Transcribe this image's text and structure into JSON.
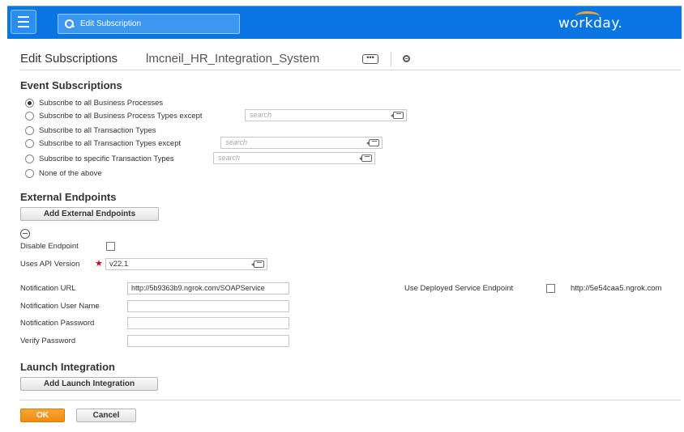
{
  "topbar": {
    "search_text": "Edit Subscription",
    "logo": "workday.",
    "colors": {
      "bar": "#0875e1",
      "logo_arc": "#f4a623"
    }
  },
  "header": {
    "title": "Edit Subscriptions",
    "subject": "lmcneil_HR_Integration_System",
    "related_actions": "•••"
  },
  "event_subscriptions": {
    "title": "Event Subscriptions",
    "options": [
      {
        "label": "Subscribe to all Business Processes",
        "checked": true
      },
      {
        "label": "Subscribe to all Business Process Types except",
        "checked": false,
        "search_placeholder": "search"
      },
      {
        "label": "Subscribe to all Transaction Types",
        "checked": false
      },
      {
        "label": "Subscribe to all Transaction Types except",
        "checked": false,
        "search_placeholder": "search"
      },
      {
        "label": "Subscribe to specific Transaction Types",
        "checked": false,
        "search_placeholder": "search"
      },
      {
        "label": "None of the above",
        "checked": false
      }
    ]
  },
  "external_endpoints": {
    "title": "External Endpoints",
    "add_button": "Add External Endpoints",
    "disable_endpoint_label": "Disable Endpoint",
    "disable_endpoint_checked": false,
    "api_version_label": "Uses API Version",
    "required_mark": "★",
    "api_version_value": "v22.1",
    "notification_url_label": "Notification URL",
    "notification_url_value": "http://5b9363b9.ngrok.com/SOAPService",
    "deployed_endpoint_label": "Use Deployed Service Endpoint",
    "deployed_endpoint_checked": false,
    "deployed_endpoint_url": "http://5e54caa5.ngrok.com",
    "user_name_label": "Notification User Name",
    "user_name_value": "",
    "password_label": "Notification Password",
    "password_value": "",
    "verify_password_label": "Verify Password",
    "verify_password_value": ""
  },
  "launch_integration": {
    "title": "Launch Integration",
    "add_button": "Add Launch Integration"
  },
  "footer": {
    "ok": "OK",
    "cancel": "Cancel",
    "colors": {
      "ok": "#f08a0c"
    }
  }
}
